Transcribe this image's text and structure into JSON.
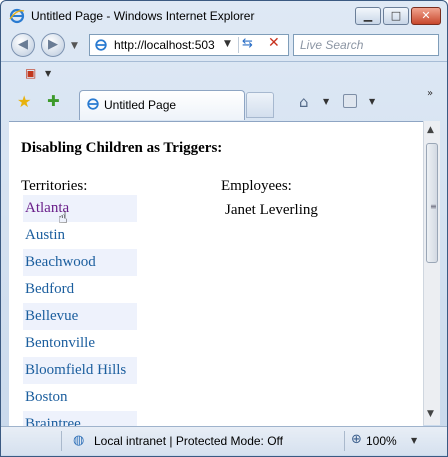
{
  "window": {
    "title": "Untitled Page - Windows Internet Explorer",
    "minimize_glyph": "▁",
    "maximize_glyph": "□",
    "close_glyph": "✕"
  },
  "navigation": {
    "address": "http://localhost:503",
    "search_placeholder": "Live Search"
  },
  "tabs": [
    {
      "label": "Untitled Page"
    }
  ],
  "page": {
    "heading": "Disabling Children as Triggers:",
    "territories_label": "Territories:",
    "employees_label": "Employees:",
    "employee_value": "Janet Leverling",
    "territories": [
      "Atlanta",
      "Austin",
      "Beachwood",
      "Bedford",
      "Bellevue",
      "Bentonville",
      "Bloomfield Hills",
      "Boston",
      "Braintree"
    ]
  },
  "status": {
    "zone": "Local intranet | Protected Mode: Off",
    "zoom": "100%"
  },
  "icons": {
    "browser": "ie-logo-icon",
    "favorites": "star-icon",
    "add_favorite": "add-favorite-icon",
    "home": "home-icon",
    "feeds": "feeds-icon",
    "refresh": "refresh-icon",
    "stop": "stop-icon",
    "zone": "globe-icon",
    "zoom": "zoom-icon"
  },
  "colors": {
    "link": "#1b5e9e",
    "visited_link": "#6a1f8a",
    "alt_row": "#eef2fc"
  }
}
